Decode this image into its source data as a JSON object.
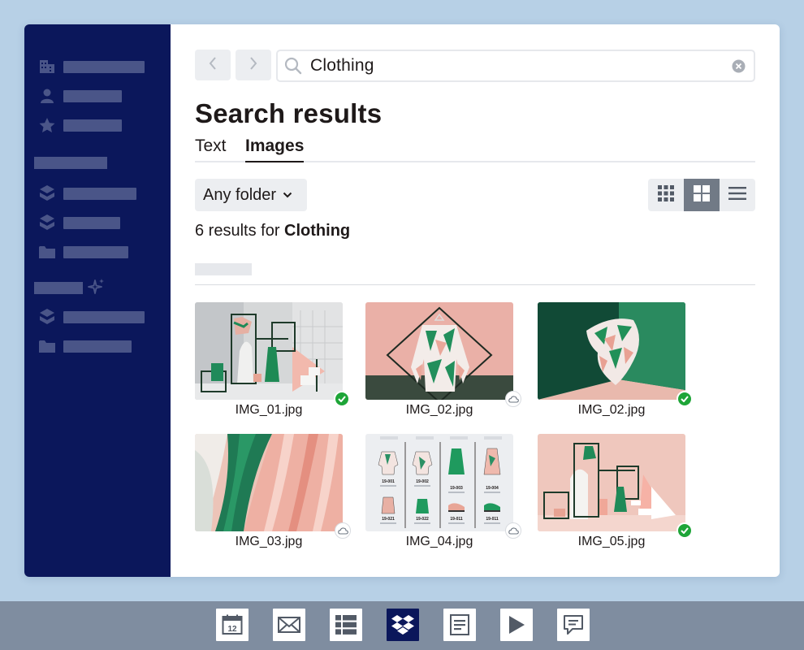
{
  "search": {
    "query": "Clothing"
  },
  "page": {
    "title": "Search results"
  },
  "tabs": [
    {
      "label": "Text"
    },
    {
      "label": "Images"
    }
  ],
  "filter": {
    "folder_label": "Any folder"
  },
  "results": {
    "count_prefix": "6 results for",
    "query": "Clothing"
  },
  "files": [
    {
      "name": "IMG_01.jpg",
      "status": "synced"
    },
    {
      "name": "IMG_02.jpg",
      "status": "cloud"
    },
    {
      "name": "IMG_02.jpg",
      "status": "synced"
    },
    {
      "name": "IMG_03.jpg",
      "status": "cloud"
    },
    {
      "name": "IMG_04.jpg",
      "status": "cloud"
    },
    {
      "name": "IMG_05.jpg",
      "status": "synced"
    }
  ],
  "catalog": {
    "top": [
      "19-001",
      "19-002",
      "19-003",
      "19-004"
    ],
    "bottom": [
      "19-021",
      "19-022",
      "19-011",
      "19-011"
    ]
  },
  "taskbar": {
    "calendar_day": "12"
  },
  "colors": {
    "sidebar": "#0b175b",
    "accent": "#1ea538",
    "background": "#b7d0e6"
  }
}
